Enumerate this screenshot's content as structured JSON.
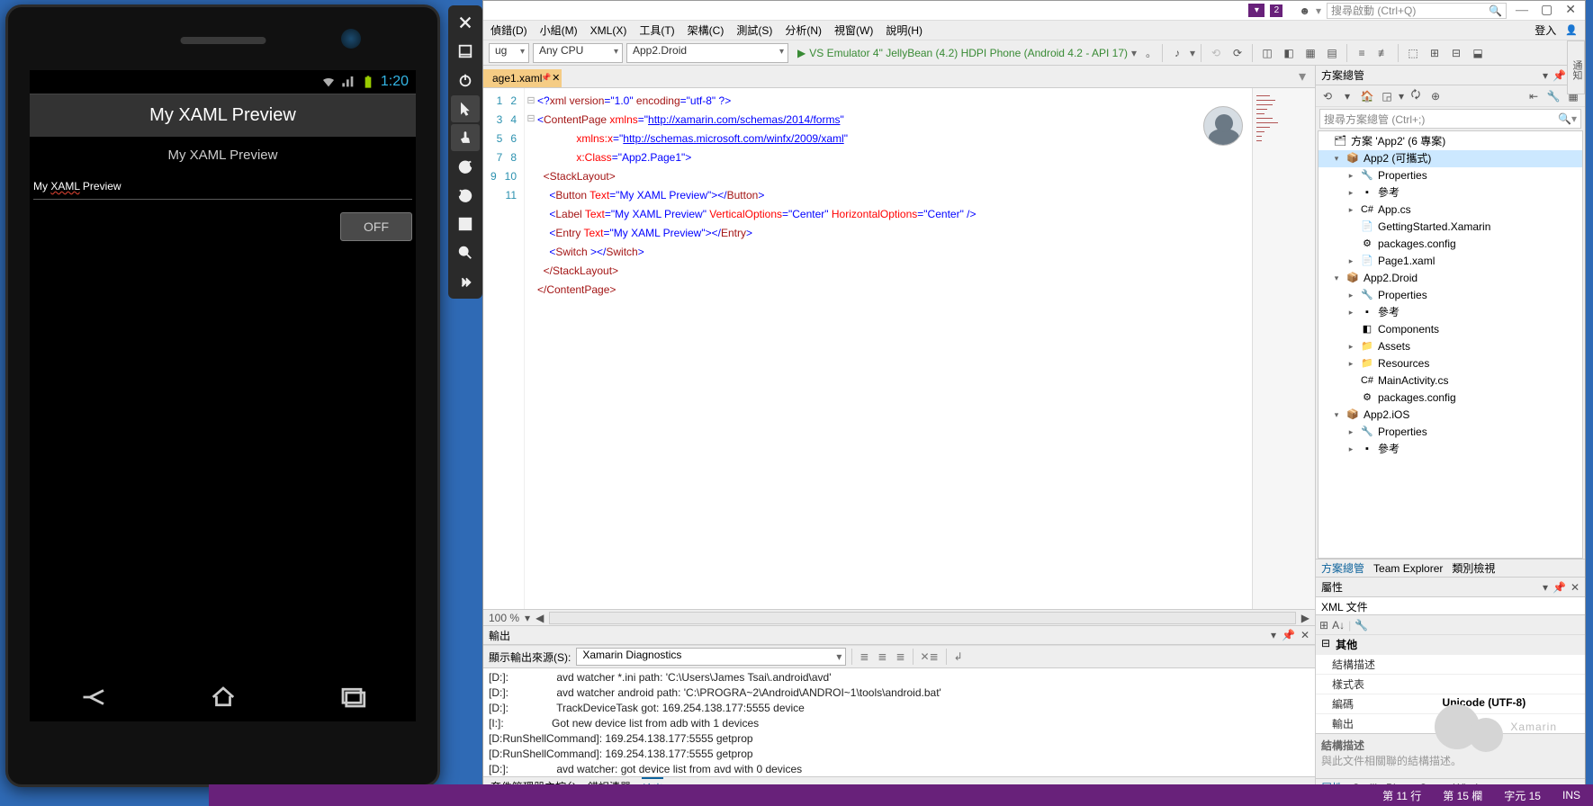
{
  "emulator": {
    "clock": "1:20",
    "title": "My XAML Preview",
    "label": "My XAML Preview",
    "entry_plain1": "My ",
    "entry_underlined": "XAML",
    "entry_plain2": " Preview",
    "switch": "OFF"
  },
  "vs": {
    "notif_badge": "2",
    "quicklaunch_placeholder": "搜尋啟動 (Ctrl+Q)",
    "menu": [
      "偵錯(D)",
      "小組(M)",
      "XML(X)",
      "工具(T)",
      "架構(C)",
      "測試(S)",
      "分析(N)",
      "視窗(W)",
      "說明(H)"
    ],
    "login": "登入",
    "toolbar": {
      "config": "ug",
      "platform": "Any CPU",
      "project": "App2.Droid",
      "target": "VS Emulator 4\" JellyBean (4.2) HDPI Phone (Android 4.2 - API 17)"
    },
    "tab": "age1.xaml",
    "zoom": "100 %",
    "code": {
      "lines": [
        "1",
        "2",
        "3",
        "4",
        "5",
        "6",
        "7",
        "8",
        "9",
        "10",
        "11"
      ],
      "l1_a": "<?",
      "l1_b": "xml version",
      "l1_c": "=\"1.0\" ",
      "l1_d": "encoding",
      "l1_e": "=\"utf-8\" ?>",
      "l2_a": "<",
      "l2_b": "ContentPage",
      "l2_c": " xmlns",
      "l2_d": "=\"",
      "l2_url": "http://xamarin.com/schemas/2014/forms",
      "l2_e": "\"",
      "l3_a": "             xmlns:x",
      "l3_b": "=\"",
      "l3_url": "http://schemas.microsoft.com/winfx/2009/xaml",
      "l3_c": "\"",
      "l4_a": "             x:Class",
      "l4_b": "=\"App2.Page1\">",
      "l5": "  <StackLayout>",
      "l6_a": "    <",
      "l6_b": "Button",
      "l6_c": " Text",
      "l6_d": "=\"My XAML Preview\"></",
      "l6_e": "Button",
      "l6_f": ">",
      "l7_a": "    <",
      "l7_b": "Label",
      "l7_c": " Text",
      "l7_d": "=\"My XAML Preview\" ",
      "l7_e": "VerticalOptions",
      "l7_f": "=\"Center\" ",
      "l7_g": "HorizontalOptions",
      "l7_h": "=\"Center\" />",
      "l8_a": "    <",
      "l8_b": "Entry",
      "l8_c": " Text",
      "l8_d": "=\"My XAML Preview\"></",
      "l8_e": "Entry",
      "l8_f": ">",
      "l9_a": "    <",
      "l9_b": "Switch",
      "l9_c": " ></",
      "l9_d": "Switch",
      "l9_e": ">",
      "l10": "  </StackLayout>",
      "l11": "</ContentPage>"
    },
    "output": {
      "title": "輸出",
      "source_label": "顯示輸出來源(S):",
      "source": "Xamarin Diagnostics",
      "lines": [
        "[D:]:                avd watcher *.ini path: 'C:\\Users\\James Tsai\\.android\\avd'",
        "[D:]:                avd watcher android path: 'C:\\PROGRA~2\\Android\\ANDROI~1\\tools\\android.bat'",
        "[D:]:                TrackDeviceTask got: 169.254.138.177:5555 device",
        "[I:]:                Got new device list from adb with 1 devices",
        "[D:RunShellCommand]: 169.254.138.177:5555 getprop",
        "[D:RunShellCommand]: 169.254.138.177:5555 getprop",
        "[D:]:                avd watcher: got device list from avd with 0 devices"
      ]
    },
    "bottom_tabs": [
      "套件管理器主控台",
      "錯誤清單",
      "輸出"
    ],
    "soln": {
      "title": "方案總管",
      "search_placeholder": "搜尋方案總管 (Ctrl+;)",
      "root": "方案 'App2' (6 專案)",
      "tree": [
        {
          "d": 1,
          "tw": "▾",
          "ic": "📦",
          "t": "App2 (可攜式)",
          "sel": true
        },
        {
          "d": 2,
          "tw": "▸",
          "ic": "🔧",
          "t": "Properties"
        },
        {
          "d": 2,
          "tw": "▸",
          "ic": "▪",
          "t": "參考"
        },
        {
          "d": 2,
          "tw": "▸",
          "ic": "C#",
          "t": "App.cs"
        },
        {
          "d": 2,
          "tw": "",
          "ic": "📄",
          "t": "GettingStarted.Xamarin"
        },
        {
          "d": 2,
          "tw": "",
          "ic": "⚙",
          "t": "packages.config"
        },
        {
          "d": 2,
          "tw": "▸",
          "ic": "📄",
          "t": "Page1.xaml"
        },
        {
          "d": 1,
          "tw": "▾",
          "ic": "📦",
          "t": "App2.Droid"
        },
        {
          "d": 2,
          "tw": "▸",
          "ic": "🔧",
          "t": "Properties"
        },
        {
          "d": 2,
          "tw": "▸",
          "ic": "▪",
          "t": "參考"
        },
        {
          "d": 2,
          "tw": "",
          "ic": "◧",
          "t": "Components"
        },
        {
          "d": 2,
          "tw": "▸",
          "ic": "📁",
          "t": "Assets"
        },
        {
          "d": 2,
          "tw": "▸",
          "ic": "📁",
          "t": "Resources"
        },
        {
          "d": 2,
          "tw": "",
          "ic": "C#",
          "t": "MainActivity.cs"
        },
        {
          "d": 2,
          "tw": "",
          "ic": "⚙",
          "t": "packages.config"
        },
        {
          "d": 1,
          "tw": "▾",
          "ic": "📦",
          "t": "App2.iOS"
        },
        {
          "d": 2,
          "tw": "▸",
          "ic": "🔧",
          "t": "Properties"
        },
        {
          "d": 2,
          "tw": "▸",
          "ic": "▪",
          "t": "參考"
        }
      ],
      "tabs": [
        "方案總管",
        "Team Explorer",
        "類別檢視"
      ]
    },
    "props": {
      "title": "屬性",
      "subtitle": "XML 文件",
      "category": "其他",
      "rows": [
        {
          "k": "結構描述",
          "v": ""
        },
        {
          "k": "樣式表",
          "v": ""
        },
        {
          "k": "編碼",
          "v": "Unicode (UTF-8)"
        },
        {
          "k": "輸出",
          "v": ""
        }
      ],
      "desc_title": "結構描述",
      "desc_body": "與此文件相關聯的結構描述。",
      "tabs": [
        "屬性",
        "Gorilla Player Status Window"
      ]
    },
    "right_rail": "通知"
  },
  "status": {
    "line": "第 11 行",
    "col": "第 15 欄",
    "ch": "字元 15",
    "ins": "INS"
  }
}
